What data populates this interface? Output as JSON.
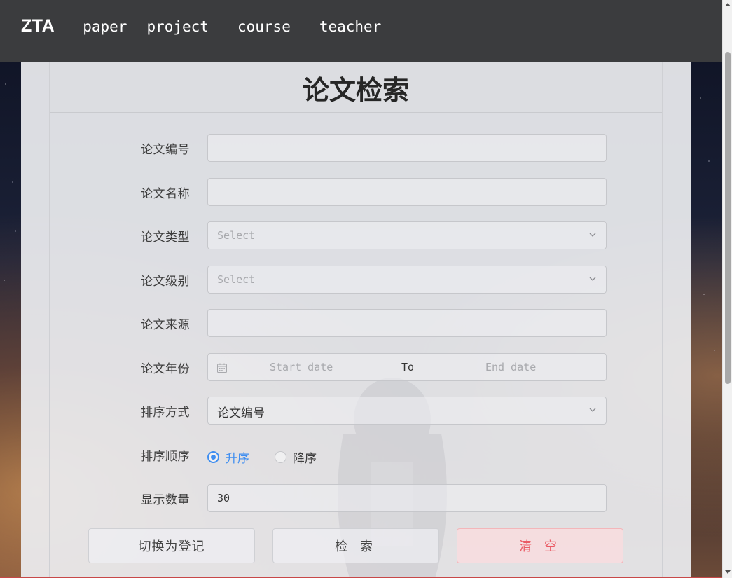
{
  "nav": {
    "brand": "ZTA",
    "items": [
      {
        "label": "paper"
      },
      {
        "label": "project"
      },
      {
        "label": "course"
      },
      {
        "label": "teacher"
      }
    ]
  },
  "page": {
    "title": "论文检索"
  },
  "form": {
    "paper_id": {
      "label": "论文编号",
      "value": ""
    },
    "paper_name": {
      "label": "论文名称",
      "value": ""
    },
    "paper_type": {
      "label": "论文类型",
      "placeholder": "Select"
    },
    "paper_level": {
      "label": "论文级别",
      "placeholder": "Select"
    },
    "paper_source": {
      "label": "论文来源",
      "value": ""
    },
    "paper_year": {
      "label": "论文年份",
      "start_placeholder": "Start date",
      "separator": "To",
      "end_placeholder": "End date"
    },
    "sort_by": {
      "label": "排序方式",
      "selected": "论文编号"
    },
    "sort_order": {
      "label": "排序顺序",
      "options": [
        "升序",
        "降序"
      ],
      "selected": "升序"
    },
    "display_count": {
      "label": "显示数量",
      "value": "30"
    }
  },
  "buttons": {
    "switch": "切换为登记",
    "search": "检 索",
    "clear": "清 空"
  },
  "colors": {
    "navbar": "#3b3c3e",
    "accent": "#3f8ef0",
    "danger": "#ea5a64"
  }
}
